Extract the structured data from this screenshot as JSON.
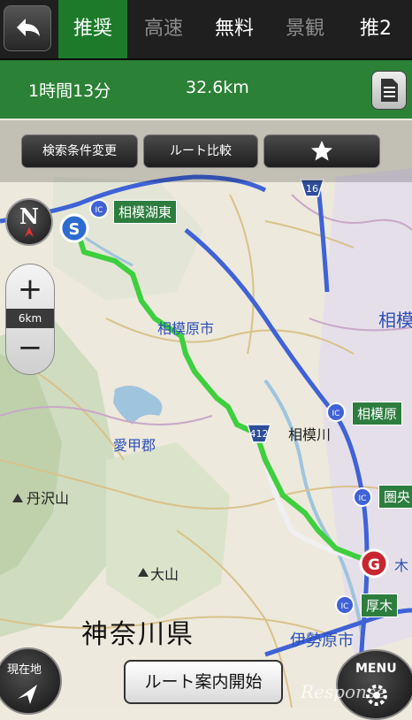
{
  "header": {
    "back_icon": "back-arrow-icon",
    "tabs": [
      {
        "label": "推奨",
        "state": "active"
      },
      {
        "label": "高速",
        "state": "dim"
      },
      {
        "label": "無料",
        "state": "normal"
      },
      {
        "label": "景観",
        "state": "dim"
      },
      {
        "label": "推2",
        "state": "normal"
      }
    ]
  },
  "route_info": {
    "time": "1時間13分",
    "distance": "32.6km",
    "detail_icon": "document-icon"
  },
  "options": {
    "search_change_label": "検索条件変更",
    "compare_label": "ルート比較",
    "favorite_icon": "star-icon"
  },
  "map": {
    "compass_label": "N",
    "zoom_plus": "+",
    "zoom_minus": "−",
    "scale": "6km",
    "start_marker": "S",
    "goal_marker": "G",
    "ic_label": "IC",
    "route_number_412": "412",
    "route_number_16": "16",
    "signs": {
      "sagamiko_east": "相模湖東",
      "sagamihara": "相模原",
      "ken": "圏央",
      "atsugi": "厚木"
    },
    "labels": {
      "sagamihara_city": "相模原市",
      "aiko_gun": "愛甲郡",
      "sagami_river": "相模川",
      "tanzawa": "丹沢山",
      "oyama": "大山",
      "kanagawa": "神奈川県",
      "isehara": "伊勢原市",
      "sagami_right": "相模",
      "ki": "木"
    }
  },
  "footer": {
    "current_location_label": "現在地",
    "start_guidance_label": "ルート案内開始",
    "menu_label": "MENU",
    "watermark": "Response"
  },
  "colors": {
    "active_tab": "#1d7a2a",
    "route": "#3ecf3e",
    "highway": "#3f62d6"
  }
}
